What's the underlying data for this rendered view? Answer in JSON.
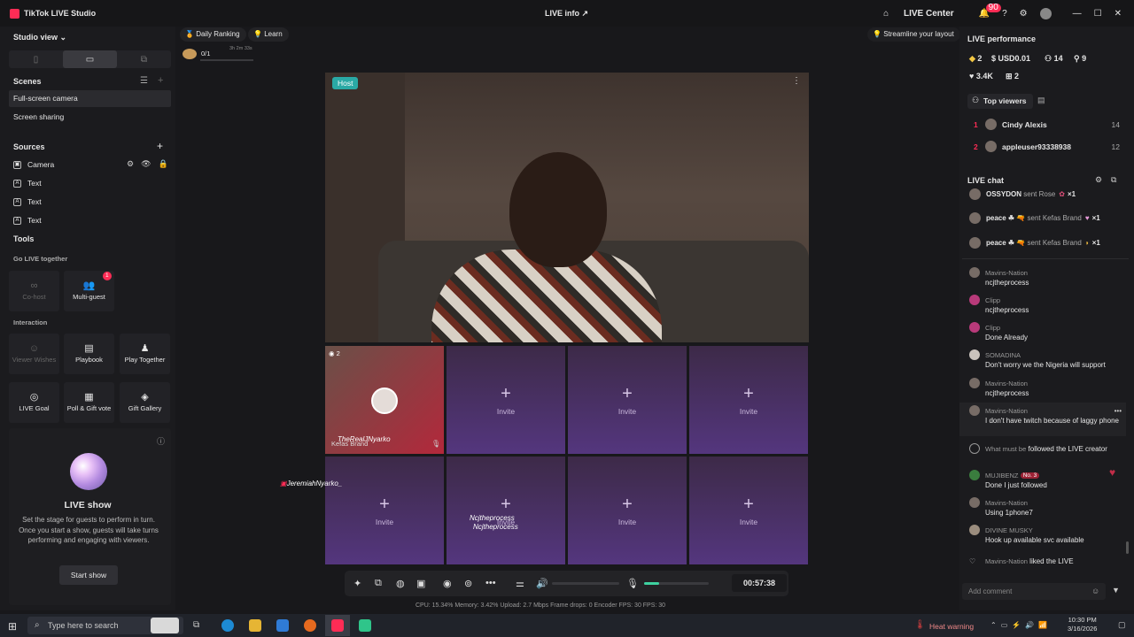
{
  "app": {
    "title": "TikTok LIVE Studio",
    "center_title": "LIVE info",
    "live_center": "LIVE Center",
    "notif_count": "90"
  },
  "left": {
    "studio_view": "Studio view",
    "scenes_title": "Scenes",
    "scenes": [
      "Full-screen camera",
      "Screen sharing"
    ],
    "sources_title": "Sources",
    "sources": [
      "Camera",
      "Text",
      "Text",
      "Text"
    ],
    "tools_title": "Tools",
    "go_live_together": "Go LIVE together",
    "cohost": "Co-host",
    "multiguest": "Multi-guest",
    "multiguest_badge": "1",
    "interaction": "Interaction",
    "viewer_wishes": "Viewer Wishes",
    "playbook": "Playbook",
    "play_together": "Play Together",
    "live_goal": "LIVE Goal",
    "poll": "Poll & Gift vote",
    "gift_gallery": "Gift Gallery",
    "liveshow_title": "LIVE show",
    "liveshow_desc": "Set the stage for guests to perform in turn. Once you start a show, guests will take turns performing and engaging with viewers.",
    "start_show": "Start show"
  },
  "top": {
    "daily_ranking": "Daily Ranking",
    "learn": "Learn",
    "rank_value": "0/1",
    "rank_time": "3h 2m 33s",
    "streamline": "Streamline your layout"
  },
  "stage": {
    "host_tag": "Host",
    "guest_count": "2",
    "guest_name": "TheRealJNyarko",
    "guest_gift": "Kefas Brand",
    "invite": "Invite",
    "overlay_name": "JeremiahNyarko_",
    "overlay_2a": "Ncjtheprocess",
    "overlay_2b": "Ncjtheprocess"
  },
  "controls": {
    "timer": "00:57:38",
    "mic_level": 0.23
  },
  "stats": "CPU: 15.34%   Memory: 3.42%   Upload: 2.7 Mbps   Frame drops: 0   Encoder FPS: 30   FPS: 30",
  "perf": {
    "title": "LIVE performance",
    "diamonds": "2",
    "usd": "USD0.01",
    "viewers": "14",
    "likes_people": "9",
    "likes": "3.4K",
    "gifts": "2"
  },
  "top_viewers": {
    "label": "Top viewers",
    "list": [
      {
        "rank": "1",
        "name": "Cindy Alexis",
        "count": "14"
      },
      {
        "rank": "2",
        "name": "appleuser93338938",
        "count": "12"
      }
    ]
  },
  "chat": {
    "title": "LIVE chat",
    "gifts": [
      {
        "user": "OSSYDON",
        "action": "sent Rose",
        "qty": "×1"
      },
      {
        "user": "peace ☘ 🔫",
        "action": "sent Kefas Brand",
        "qty": "×1"
      },
      {
        "user": "peace ☘ 🔫",
        "action": "sent Kefas Brand",
        "qty": "×1"
      }
    ],
    "messages": [
      {
        "user": "Mavins-Nation",
        "text": "ncjtheprocess"
      },
      {
        "user": "Clipp",
        "text": "ncjtheprocess"
      },
      {
        "user": "Clipp",
        "text": "Done Already"
      },
      {
        "user": "SOMADINA",
        "text": "Don't worry we the Nigeria will support"
      },
      {
        "user": "Mavins-Nation",
        "text": "ncjtheprocess"
      },
      {
        "user": "Mavins-Nation",
        "text": "I don't have twitch because of laggy phone"
      }
    ],
    "follow": {
      "user": "What must be",
      "text": "followed the LIVE creator"
    },
    "messages2": [
      {
        "user": "MUJIBENZ",
        "badge": "No. 3",
        "text": "Done I just followed"
      },
      {
        "user": "Mavins-Nation",
        "text": "Using 1phone7"
      },
      {
        "user": "DIVINE MUSKY",
        "text": "Hook up available svc available"
      }
    ],
    "like": {
      "user": "Mavins-Nation",
      "text": "liked the LIVE"
    },
    "comment_placeholder": "Add comment"
  },
  "taskbar": {
    "search": "Type here to search",
    "heat": "Heat warning",
    "time": "10:30 PM",
    "date": "3/16/2026"
  }
}
